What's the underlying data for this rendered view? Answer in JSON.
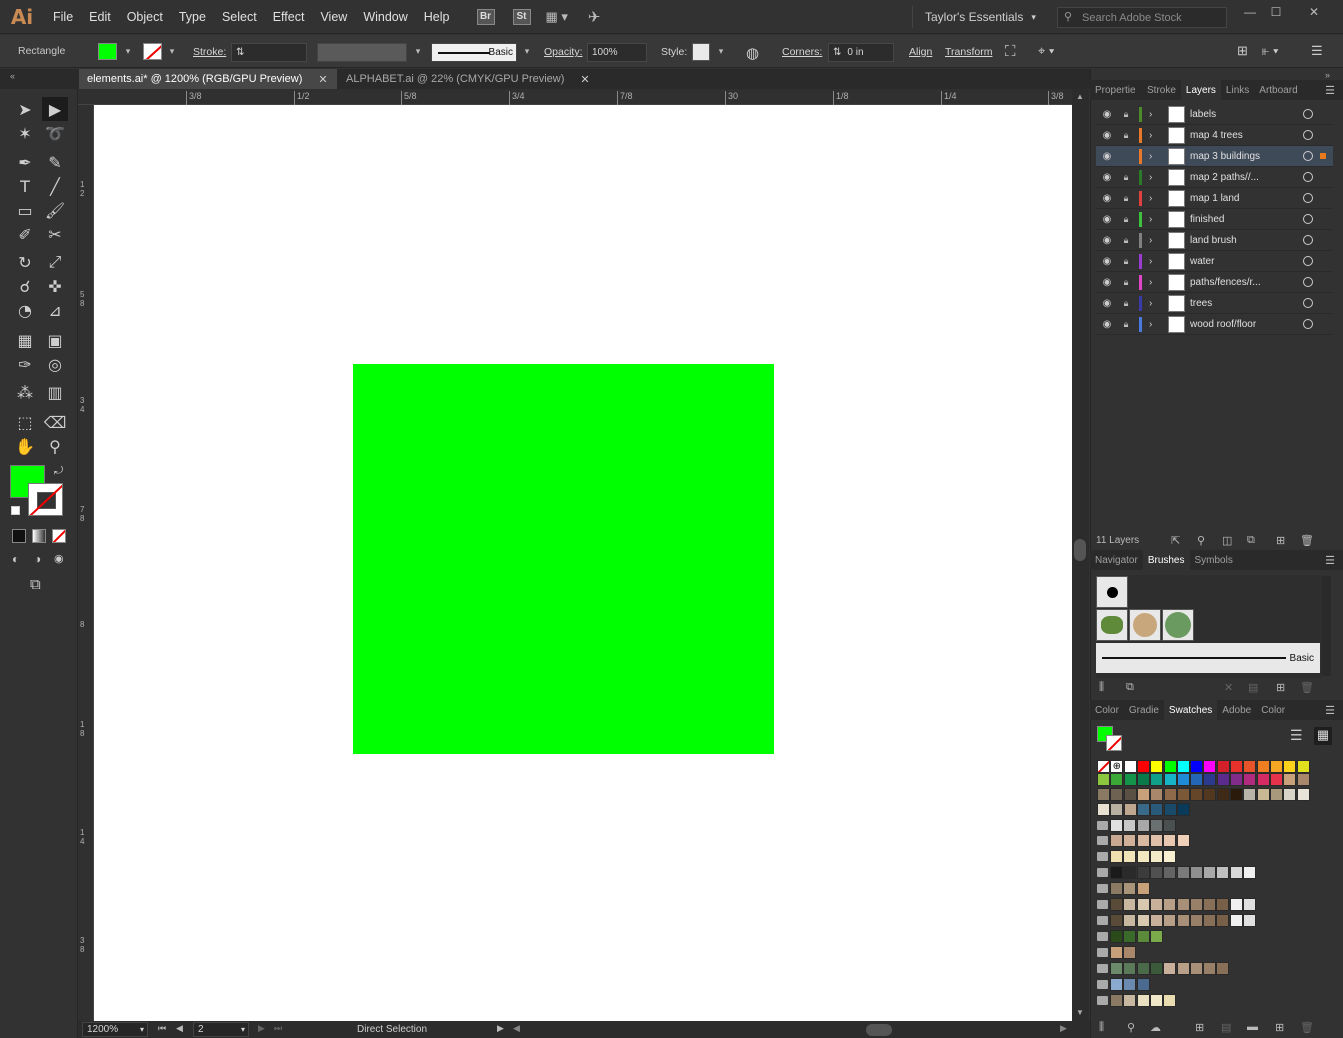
{
  "app": {
    "logo": "Ai"
  },
  "menu": [
    "File",
    "Edit",
    "Object",
    "Type",
    "Select",
    "Effect",
    "View",
    "Window",
    "Help"
  ],
  "menu_buttons": [
    "Br",
    "St"
  ],
  "workspace": "Taylor's Essentials",
  "search_placeholder": "Search Adobe Stock",
  "control": {
    "tool_name": "Rectangle",
    "stroke_label": "Stroke:",
    "stroke_style": "Basic",
    "opacity_label": "Opacity:",
    "opacity_value": "100%",
    "style_label": "Style:",
    "corners_label": "Corners:",
    "corners_value": "0 in",
    "align_label": "Align",
    "transform_label": "Transform",
    "fill_color": "#00ff00"
  },
  "tabs": [
    {
      "label": "elements.ai* @ 1200% (RGB/GPU Preview)",
      "active": true
    },
    {
      "label": "ALPHABET.ai @ 22% (CMYK/GPU Preview)",
      "active": false
    }
  ],
  "ruler_h": [
    "3/8",
    "1/2",
    "5/8",
    "3/4",
    "7/8",
    "30",
    "1/8",
    "1/4",
    "3/8"
  ],
  "ruler_v": [
    "1\n2",
    "5\n8",
    "3\n4",
    "7\n8",
    "8",
    "1\n8",
    "1\n4",
    "3\n8"
  ],
  "canvas": {
    "artboard_color": "#ffffff",
    "rect_color": "#00ff00"
  },
  "status": {
    "zoom": "1200%",
    "artboard": "2",
    "tool": "Direct Selection"
  },
  "layers_panel": {
    "tabs": [
      "Propertie",
      "Stroke",
      "Layers",
      "Links",
      "Artboard"
    ],
    "active_tab": "Layers",
    "layers": [
      {
        "name": "labels",
        "color": "#4c8a2a",
        "active": false
      },
      {
        "name": "map 4 trees",
        "color": "#e8782a",
        "active": false
      },
      {
        "name": "map 3 buildings",
        "color": "#e8782a",
        "active": true
      },
      {
        "name": "map 2 paths//...",
        "color": "#2a7a2a",
        "active": false
      },
      {
        "name": "map 1 land",
        "color": "#e04040",
        "active": false
      },
      {
        "name": "finished",
        "color": "#3cc23c",
        "active": false
      },
      {
        "name": "land brush",
        "color": "#808080",
        "active": false
      },
      {
        "name": "water",
        "color": "#9a3ccf",
        "active": false
      },
      {
        "name": "paths/fences/r...",
        "color": "#e045c8",
        "active": false
      },
      {
        "name": "trees",
        "color": "#3a3aa8",
        "active": false
      },
      {
        "name": "wood  roof/floor",
        "color": "#4a7ae0",
        "active": false
      }
    ],
    "count": "11 Layers"
  },
  "brushes_panel": {
    "tabs": [
      "Navigator",
      "Brushes",
      "Symbols"
    ],
    "active_tab": "Brushes",
    "basic_label": "Basic"
  },
  "swatches_panel": {
    "tabs": [
      "Color",
      "Gradie",
      "Swatches",
      "Adobe",
      "Color"
    ],
    "active_tab": "Swatches"
  }
}
